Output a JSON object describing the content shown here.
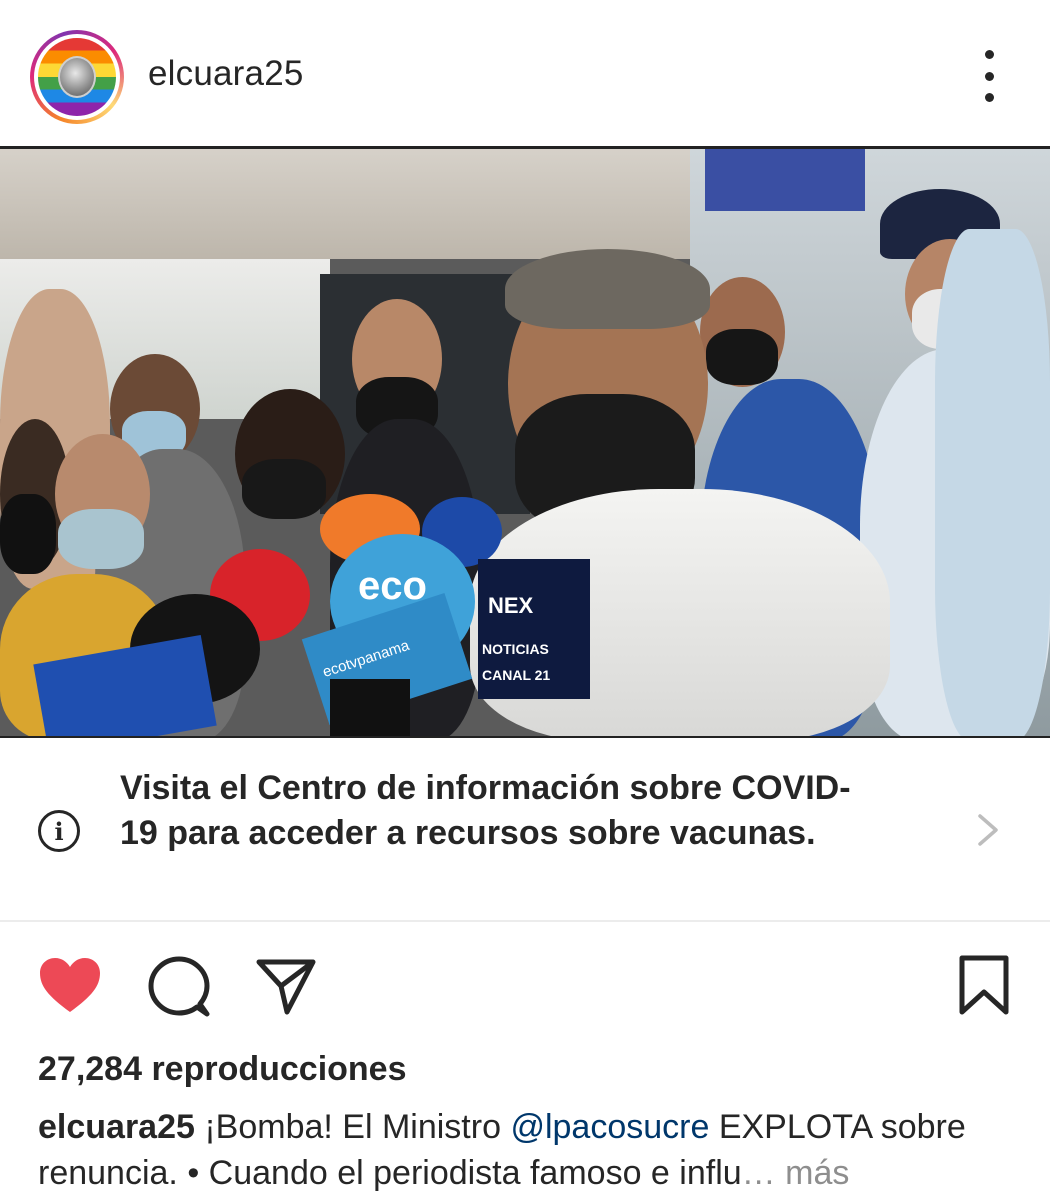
{
  "post": {
    "username": "elcuara25",
    "covid_banner": {
      "text": "Visita el Centro de información sobre COVID-19 para acceder a recursos sobre vacunas.",
      "info_icon": "info-icon",
      "chevron_icon": "chevron-right-icon"
    },
    "views": "27,284 reproducciones",
    "caption": {
      "username": "elcuara25",
      "text_before": " ¡Bomba! El Ministro ",
      "mention": "@lpacosucre",
      "text_after": " EXPLOTA sobre renuncia. • Cuando el periodista famoso e influ",
      "ellipsis": "…",
      "more": " más"
    },
    "media": {
      "mic_labels": {
        "nex": "NEX",
        "noticias": "NOTICIAS",
        "canal": "CANAL 21",
        "eco": "eco",
        "ecopanama": "ecotvpanama"
      }
    },
    "colors": {
      "heart": "#ed4956",
      "mention": "#00376b",
      "more": "#8e8e8e",
      "text": "#262626"
    }
  }
}
